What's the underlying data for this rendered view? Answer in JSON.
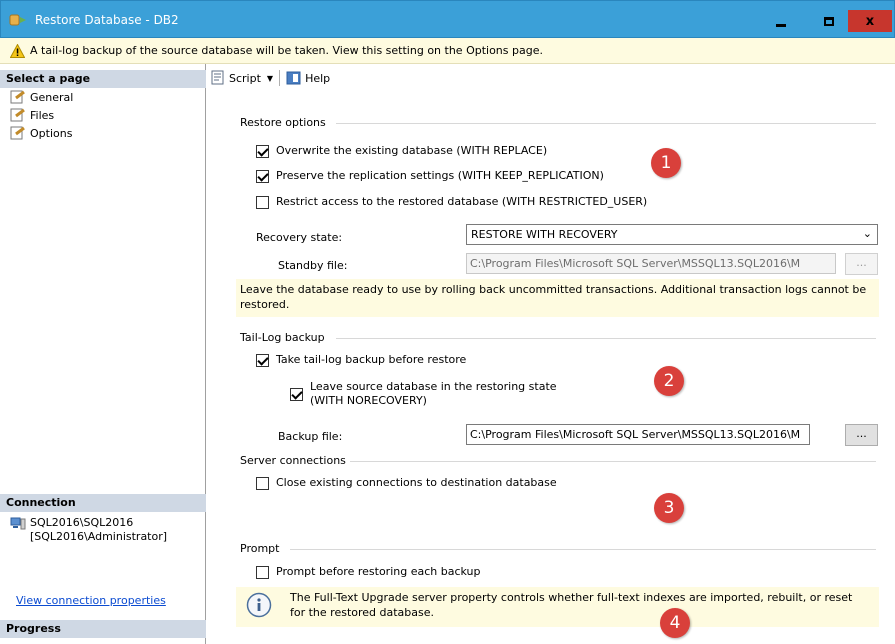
{
  "window": {
    "title": "Restore Database - DB2",
    "minimize_icon": "minimize-icon",
    "maximize_icon": "maximize-icon",
    "close_icon": "close-icon",
    "close_glyph": "x"
  },
  "warning": {
    "text": "A tail-log backup of the source database will be taken. View this setting on the Options page.",
    "icon": "warning-icon"
  },
  "left_pane": {
    "select_page_header": "Select a page",
    "pages": [
      {
        "label": "General",
        "icon": "page-wrench-icon"
      },
      {
        "label": "Files",
        "icon": "page-wrench-icon"
      },
      {
        "label": "Options",
        "icon": "page-wrench-icon"
      }
    ],
    "connection_header": "Connection",
    "connection_server": "SQL2016\\SQL2016",
    "connection_user": "[SQL2016\\Administrator]",
    "connection_icon": "server-connection-icon",
    "view_connection_link": "View connection properties",
    "progress_header": "Progress"
  },
  "toolbar": {
    "script_label": "Script",
    "script_icon": "script-icon",
    "help_label": "Help",
    "help_icon": "help-icon"
  },
  "restore_options": {
    "section_label": "Restore options",
    "overwrite_label": "Overwrite the existing database (WITH REPLACE)",
    "overwrite_checked": true,
    "preserve_label": "Preserve the replication settings (WITH KEEP_REPLICATION)",
    "preserve_checked": true,
    "restrict_label": "Restrict access to the restored database (WITH RESTRICTED_USER)",
    "restrict_checked": false,
    "recovery_state_label": "Recovery state:",
    "recovery_state_value": "RESTORE WITH RECOVERY",
    "standby_file_label": "Standby file:",
    "standby_file_value": "C:\\Program Files\\Microsoft SQL Server\\MSSQL13.SQL2016\\M",
    "standby_browse_label": "...",
    "recovery_description": "Leave the database ready to use by rolling back uncommitted transactions. Additional transaction logs cannot be restored."
  },
  "tail_log": {
    "section_label": "Tail-Log backup",
    "take_backup_label": "Take tail-log backup before restore",
    "take_backup_checked": true,
    "leave_restoring_line1": "Leave source database in the restoring state",
    "leave_restoring_line2": "(WITH NORECOVERY)",
    "leave_restoring_checked": true,
    "backup_file_label": "Backup file:",
    "backup_file_value": "C:\\Program Files\\Microsoft SQL Server\\MSSQL13.SQL2016\\M",
    "backup_browse_label": "..."
  },
  "server_connections": {
    "section_label": "Server connections",
    "close_connections_label": "Close existing connections to destination database",
    "close_connections_checked": false
  },
  "prompt": {
    "section_label": "Prompt",
    "prompt_label": "Prompt before restoring each backup",
    "prompt_checked": false,
    "info_text": "The Full-Text Upgrade server property controls whether full-text indexes are imported, rebuilt, or reset for the restored database.",
    "info_icon": "info-icon"
  },
  "badges": [
    "1",
    "2",
    "3",
    "4"
  ],
  "colors": {
    "titlebar": "#3ba0d8",
    "close_button": "#c7362d",
    "warning_bar": "#fefbe0",
    "pane_header": "#cfd8e4",
    "badge": "#d9403b",
    "link": "#0b4bd1"
  }
}
